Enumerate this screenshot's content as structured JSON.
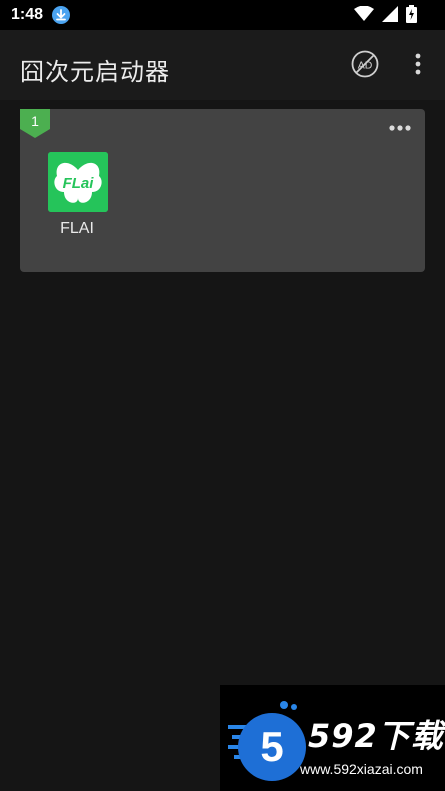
{
  "status_bar": {
    "time": "1:48",
    "icons": [
      "download-icon",
      "wifi-icon",
      "signal-icon",
      "battery-icon"
    ]
  },
  "app_bar": {
    "title": "囧次元启动器",
    "actions": [
      "ad-off-icon",
      "more-vert-icon"
    ]
  },
  "group": {
    "number": "1",
    "badge_color": "#4caf50",
    "apps": [
      {
        "label": "FLAI",
        "icon": "flai-app-icon",
        "icon_text": "FLai",
        "icon_color": "#25c45a"
      }
    ]
  },
  "watermark": {
    "brand": "592下载",
    "logo_digit": "5",
    "url": "www.592xiazai.com"
  }
}
